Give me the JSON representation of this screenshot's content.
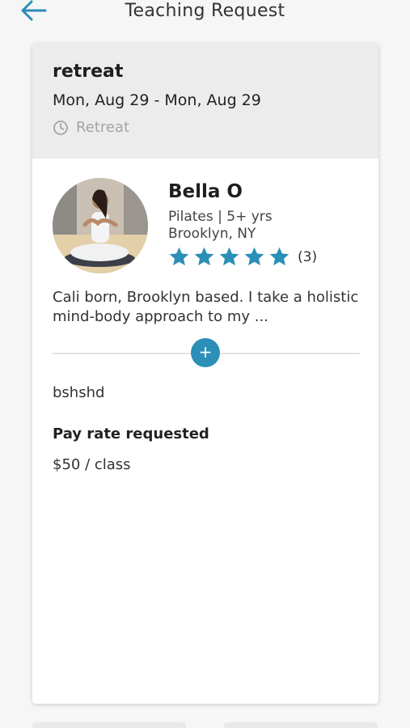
{
  "header": {
    "title": "Teaching Request",
    "back_icon": "arrow-left-icon",
    "accent_color": "#2b8fb8"
  },
  "event": {
    "name": "retreat",
    "dates": "Mon, Aug 29 - Mon, Aug 29",
    "type_icon": "clock-icon",
    "type": "Retreat"
  },
  "profile": {
    "name": "Bella O",
    "specialty": "Pilates | 5+ yrs",
    "location": "Brooklyn, NY",
    "rating_stars": 5,
    "review_count": "(3)",
    "bio": "Cali born, Brooklyn based. I take a holistic mind-body approach to my ..."
  },
  "expand_button": {
    "label": "+"
  },
  "request": {
    "note": "bshshd",
    "pay_label": "Pay rate requested",
    "pay_value": "$50 / class"
  }
}
